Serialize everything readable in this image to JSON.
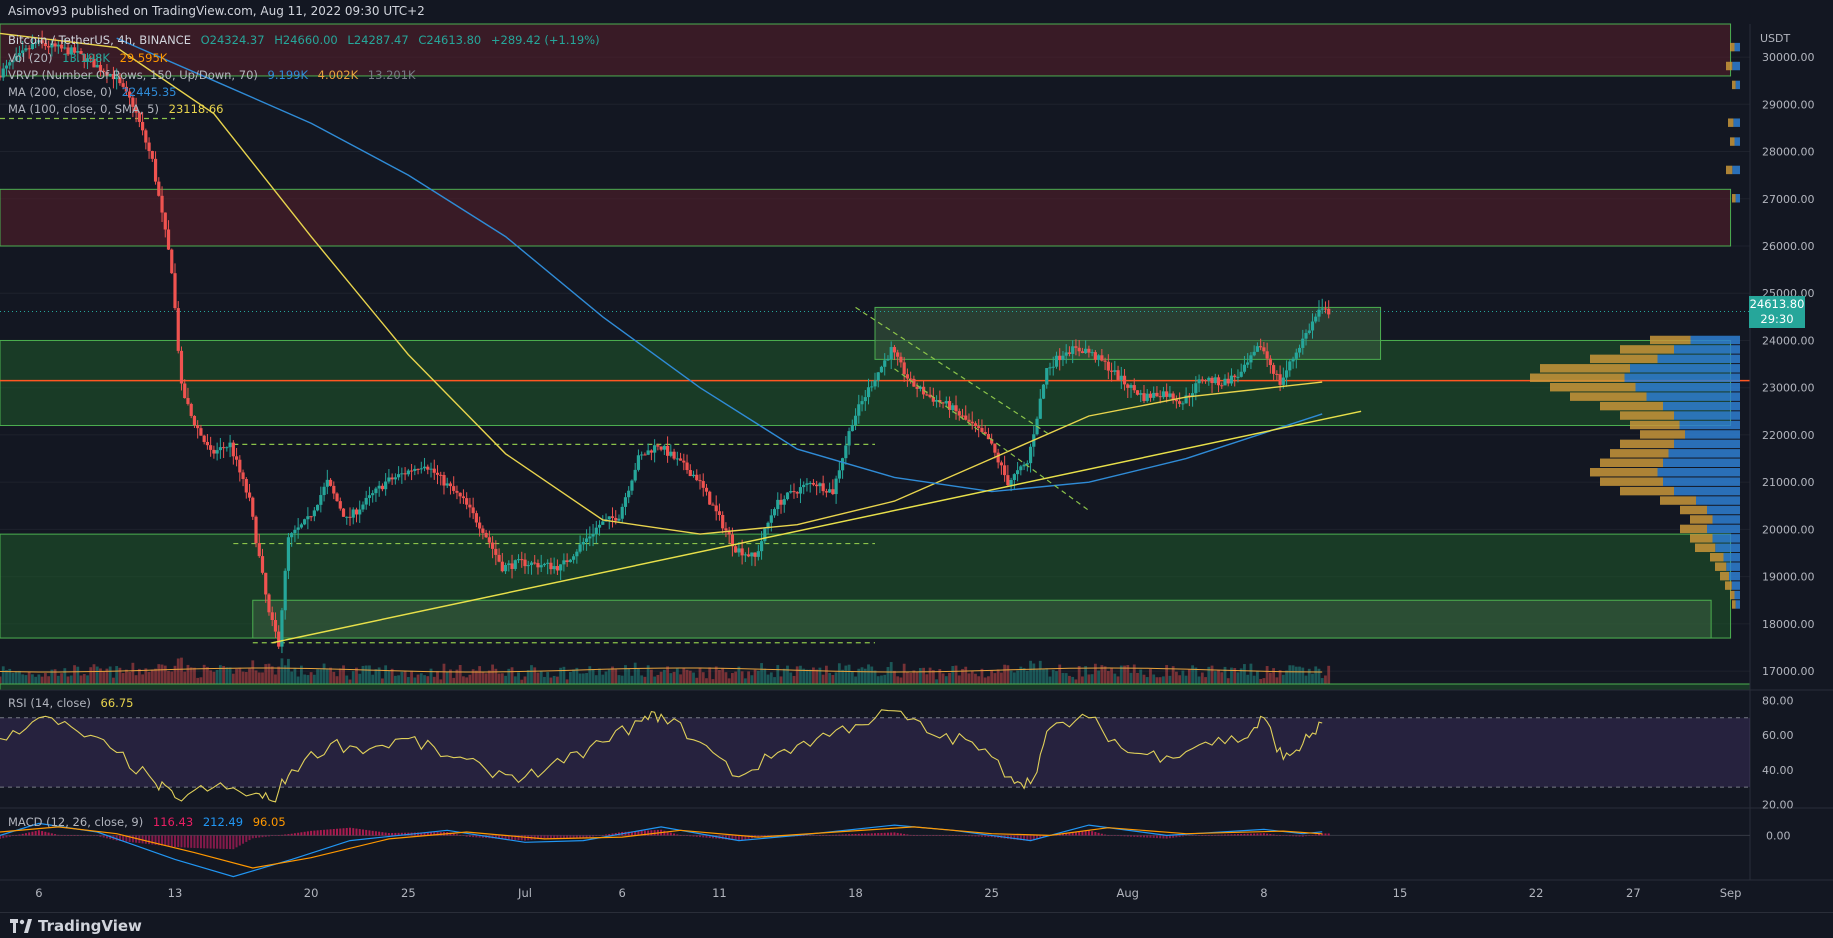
{
  "header": {
    "publisher": "Asimov93 published on TradingView.com, Aug 11, 2022 09:30 UTC+2"
  },
  "legend": {
    "symbol": "Bitcoin / TetherUS, 4h, BINANCE",
    "open": "O24324.37",
    "high": "H24660.00",
    "low": "L24287.47",
    "close": "C24613.80",
    "change": "+289.42 (+1.19%)",
    "vol_label": "Vol (20)",
    "vol_v1": "13.198K",
    "vol_v2": "29.595K",
    "vrvp_label": "VRVP (Number Of Rows, 150, Up/Down, 70)",
    "vrvp_v1": "9.199K",
    "vrvp_v2": "4.002K",
    "vrvp_v3": "13.201K",
    "ma200_label": "MA (200, close, 0)",
    "ma200_value": "22445.35",
    "ma100_label": "MA (100, close, 0, SMA, 5)",
    "ma100_value": "23118.66",
    "rsi_label": "RSI (14, close)",
    "rsi_value": "66.75",
    "macd_label": "MACD (12, 26, close, 9)",
    "macd_v1": "116.43",
    "macd_v2": "212.49",
    "macd_v3": "96.05"
  },
  "price_tag": {
    "price": "24613.80",
    "countdown": "29:30"
  },
  "footer": {
    "brand": "TradingView"
  },
  "colors": {
    "background": "#131722",
    "up": "#26a69a",
    "down": "#ef5350",
    "ma100": "#e8d44d",
    "ma200": "#2f8bd6",
    "zone_green": "#1f5a2a",
    "zone_red": "#5a1f2a",
    "rsi": "#e0d05a",
    "macd": "#2196f3",
    "signal": "#ff9800"
  },
  "chart_data": [
    {
      "type": "candlestick",
      "title": "Bitcoin / TetherUS, 4h, BINANCE",
      "y_axis_label": "USDT",
      "yticks": [
        17000,
        18000,
        19000,
        20000,
        21000,
        22000,
        23000,
        24000,
        25000,
        26000,
        27000,
        28000,
        29000,
        30000
      ],
      "xticks": [
        "6",
        "13",
        "20",
        "25",
        "Jul",
        "6",
        "11",
        "18",
        "25",
        "Aug",
        "8",
        "15",
        "22",
        "27",
        "Sep"
      ],
      "ylim": [
        16600,
        30700
      ],
      "x_range": [
        "2022-06-04",
        "2022-09-02"
      ],
      "price_path": [
        [
          "2022-06-04",
          29600
        ],
        [
          "2022-06-06",
          30300
        ],
        [
          "2022-06-08",
          30100
        ],
        [
          "2022-06-10",
          29600
        ],
        [
          "2022-06-11",
          29000
        ],
        [
          "2022-06-12",
          27800
        ],
        [
          "2022-06-13",
          25500
        ],
        [
          "2022-06-13T12",
          23000
        ],
        [
          "2022-06-14",
          22400
        ],
        [
          "2022-06-15",
          21600
        ],
        [
          "2022-06-16",
          21800
        ],
        [
          "2022-06-17",
          20600
        ],
        [
          "2022-06-18",
          18200
        ],
        [
          "2022-06-18T12",
          17600
        ],
        [
          "2022-06-19",
          19800
        ],
        [
          "2022-06-20",
          20200
        ],
        [
          "2022-06-21",
          21000
        ],
        [
          "2022-06-22",
          20200
        ],
        [
          "2022-06-24",
          21000
        ],
        [
          "2022-06-26",
          21400
        ],
        [
          "2022-06-28",
          20600
        ],
        [
          "2022-06-29",
          20000
        ],
        [
          "2022-06-30",
          19200
        ],
        [
          "2022-07-01",
          19300
        ],
        [
          "2022-07-03",
          19200
        ],
        [
          "2022-07-05",
          20100
        ],
        [
          "2022-07-06",
          20300
        ],
        [
          "2022-07-07",
          21500
        ],
        [
          "2022-07-08",
          21800
        ],
        [
          "2022-07-10",
          21100
        ],
        [
          "2022-07-12",
          19600
        ],
        [
          "2022-07-13",
          19400
        ],
        [
          "2022-07-14",
          20500
        ],
        [
          "2022-07-15",
          20800
        ],
        [
          "2022-07-16",
          21000
        ],
        [
          "2022-07-17",
          20800
        ],
        [
          "2022-07-18",
          22300
        ],
        [
          "2022-07-19",
          23100
        ],
        [
          "2022-07-20",
          23800
        ],
        [
          "2022-07-21",
          23100
        ],
        [
          "2022-07-22",
          22800
        ],
        [
          "2022-07-23",
          22600
        ],
        [
          "2022-07-25",
          21900
        ],
        [
          "2022-07-26",
          21000
        ],
        [
          "2022-07-27",
          21400
        ],
        [
          "2022-07-28",
          23400
        ],
        [
          "2022-07-29",
          23800
        ],
        [
          "2022-07-30",
          23800
        ],
        [
          "2022-07-31",
          23500
        ],
        [
          "2022-08-01",
          23100
        ],
        [
          "2022-08-02",
          22800
        ],
        [
          "2022-08-03",
          22900
        ],
        [
          "2022-08-04",
          22700
        ],
        [
          "2022-08-05",
          23200
        ],
        [
          "2022-08-06",
          23100
        ],
        [
          "2022-08-07",
          23300
        ],
        [
          "2022-08-08",
          23900
        ],
        [
          "2022-08-09",
          23100
        ],
        [
          "2022-08-10",
          23900
        ],
        [
          "2022-08-11",
          24614
        ]
      ],
      "ma100": [
        [
          "2022-06-04",
          30500
        ],
        [
          "2022-06-10",
          30200
        ],
        [
          "2022-06-15",
          28800
        ],
        [
          "2022-06-20",
          26200
        ],
        [
          "2022-06-25",
          23700
        ],
        [
          "2022-06-30",
          21600
        ],
        [
          "2022-07-05",
          20200
        ],
        [
          "2022-07-10",
          19900
        ],
        [
          "2022-07-15",
          20100
        ],
        [
          "2022-07-20",
          20600
        ],
        [
          "2022-07-25",
          21500
        ],
        [
          "2022-07-30",
          22400
        ],
        [
          "2022-08-04",
          22800
        ],
        [
          "2022-08-11",
          23119
        ]
      ],
      "ma200": [
        [
          "2022-06-10",
          30400
        ],
        [
          "2022-06-15",
          29500
        ],
        [
          "2022-06-20",
          28600
        ],
        [
          "2022-06-25",
          27500
        ],
        [
          "2022-06-30",
          26200
        ],
        [
          "2022-07-05",
          24500
        ],
        [
          "2022-07-10",
          23000
        ],
        [
          "2022-07-15",
          21700
        ],
        [
          "2022-07-20",
          21100
        ],
        [
          "2022-07-25",
          20800
        ],
        [
          "2022-07-30",
          21000
        ],
        [
          "2022-08-04",
          21500
        ],
        [
          "2022-08-11",
          22445
        ]
      ],
      "zones": [
        {
          "kind": "resistance",
          "y": [
            29600,
            30700
          ],
          "x": [
            "2022-06-04",
            "2022-09-01"
          ]
        },
        {
          "kind": "resistance",
          "y": [
            26000,
            27200
          ],
          "x": [
            "2022-06-04",
            "2022-09-01"
          ]
        },
        {
          "kind": "support",
          "y": [
            22200,
            24000
          ],
          "x": [
            "2022-06-04",
            "2022-09-01"
          ]
        },
        {
          "kind": "support",
          "y": [
            17700,
            19900
          ],
          "x": [
            "2022-06-04",
            "2022-09-01"
          ]
        },
        {
          "kind": "box",
          "y": [
            17700,
            18500
          ],
          "x": [
            "2022-06-17",
            "2022-08-31"
          ]
        },
        {
          "kind": "box",
          "y": [
            23600,
            24700
          ],
          "x": [
            "2022-07-19",
            "2022-08-14"
          ]
        }
      ],
      "levels": [
        {
          "y": 23150,
          "style": "solid",
          "color": "#ff5722"
        },
        {
          "y": 28700,
          "style": "dashed",
          "x": [
            "2022-06-04",
            "2022-06-13"
          ]
        },
        {
          "y": 21800,
          "style": "dashed",
          "x": [
            "2022-06-16",
            "2022-07-19"
          ]
        },
        {
          "y": 19700,
          "style": "dashed",
          "x": [
            "2022-06-16",
            "2022-07-19"
          ]
        },
        {
          "y": 17600,
          "style": "dashed",
          "x": [
            "2022-06-17",
            "2022-07-19"
          ]
        }
      ],
      "trendline": [
        [
          "2022-06-18",
          17600
        ],
        [
          "2022-08-13",
          22500
        ]
      ],
      "channel": [
        [
          [
            "2022-07-18",
            24700
          ],
          [
            "2022-07-28",
            22000
          ]
        ],
        [
          [
            "2022-07-20",
            23400
          ],
          [
            "2022-07-30",
            20400
          ]
        ]
      ],
      "volume_profile": [
        [
          30200,
          10
        ],
        [
          29800,
          14
        ],
        [
          29400,
          8
        ],
        [
          28600,
          12
        ],
        [
          28200,
          10
        ],
        [
          27600,
          14
        ],
        [
          27000,
          8
        ],
        [
          24000,
          90
        ],
        [
          23800,
          120
        ],
        [
          23600,
          150
        ],
        [
          23400,
          200
        ],
        [
          23200,
          210
        ],
        [
          23000,
          190
        ],
        [
          22800,
          170
        ],
        [
          22600,
          140
        ],
        [
          22400,
          120
        ],
        [
          22200,
          110
        ],
        [
          22000,
          100
        ],
        [
          21800,
          120
        ],
        [
          21600,
          130
        ],
        [
          21400,
          140
        ],
        [
          21200,
          150
        ],
        [
          21000,
          140
        ],
        [
          20800,
          120
        ],
        [
          20600,
          80
        ],
        [
          20400,
          60
        ],
        [
          20200,
          50
        ],
        [
          20000,
          60
        ],
        [
          19800,
          50
        ],
        [
          19600,
          45
        ],
        [
          19400,
          30
        ],
        [
          19200,
          25
        ],
        [
          19000,
          20
        ],
        [
          18800,
          15
        ],
        [
          18600,
          10
        ],
        [
          18400,
          8
        ]
      ]
    },
    {
      "type": "line",
      "title": "RSI (14, close)",
      "yticks": [
        20,
        40,
        60,
        80
      ],
      "ylim": [
        18,
        86
      ],
      "bands": [
        30,
        70
      ],
      "values": [
        [
          "2022-06-04",
          58
        ],
        [
          "2022-06-06",
          70
        ],
        [
          "2022-06-08",
          62
        ],
        [
          "2022-06-10",
          50
        ],
        [
          "2022-06-12",
          32
        ],
        [
          "2022-06-13",
          24
        ],
        [
          "2022-06-15",
          30
        ],
        [
          "2022-06-17",
          26
        ],
        [
          "2022-06-18",
          22
        ],
        [
          "2022-06-19",
          40
        ],
        [
          "2022-06-21",
          55
        ],
        [
          "2022-06-23",
          52
        ],
        [
          "2022-06-25",
          58
        ],
        [
          "2022-06-27",
          48
        ],
        [
          "2022-06-29",
          40
        ],
        [
          "2022-07-01",
          36
        ],
        [
          "2022-07-03",
          44
        ],
        [
          "2022-07-05",
          56
        ],
        [
          "2022-07-07",
          68
        ],
        [
          "2022-07-08",
          72
        ],
        [
          "2022-07-10",
          56
        ],
        [
          "2022-07-12",
          36
        ],
        [
          "2022-07-14",
          50
        ],
        [
          "2022-07-16",
          58
        ],
        [
          "2022-07-18",
          66
        ],
        [
          "2022-07-20",
          74
        ],
        [
          "2022-07-22",
          60
        ],
        [
          "2022-07-24",
          56
        ],
        [
          "2022-07-26",
          36
        ],
        [
          "2022-07-27",
          32
        ],
        [
          "2022-07-28",
          64
        ],
        [
          "2022-07-30",
          70
        ],
        [
          "2022-08-01",
          50
        ],
        [
          "2022-08-03",
          48
        ],
        [
          "2022-08-05",
          56
        ],
        [
          "2022-08-07",
          58
        ],
        [
          "2022-08-08",
          70
        ],
        [
          "2022-08-09",
          46
        ],
        [
          "2022-08-10",
          55
        ],
        [
          "2022-08-11",
          67
        ]
      ]
    },
    {
      "type": "line",
      "title": "MACD (12, 26, close, 9)",
      "yticks": [
        0
      ],
      "ylim": [
        -2600,
        1600
      ],
      "macd": [
        [
          "2022-06-04",
          0
        ],
        [
          "2022-06-06",
          700
        ],
        [
          "2022-06-09",
          200
        ],
        [
          "2022-06-13",
          -1400
        ],
        [
          "2022-06-16",
          -2400
        ],
        [
          "2022-06-19",
          -1400
        ],
        [
          "2022-06-22",
          -300
        ],
        [
          "2022-06-27",
          300
        ],
        [
          "2022-07-01",
          -400
        ],
        [
          "2022-07-04",
          -300
        ],
        [
          "2022-07-08",
          500
        ],
        [
          "2022-07-12",
          -300
        ],
        [
          "2022-07-15",
          0
        ],
        [
          "2022-07-20",
          600
        ],
        [
          "2022-07-23",
          300
        ],
        [
          "2022-07-27",
          -300
        ],
        [
          "2022-07-30",
          600
        ],
        [
          "2022-08-03",
          0
        ],
        [
          "2022-08-08",
          350
        ],
        [
          "2022-08-10",
          100
        ],
        [
          "2022-08-11",
          212
        ]
      ],
      "signal": [
        [
          "2022-06-04",
          200
        ],
        [
          "2022-06-07",
          500
        ],
        [
          "2022-06-10",
          100
        ],
        [
          "2022-06-14",
          -1000
        ],
        [
          "2022-06-17",
          -1900
        ],
        [
          "2022-06-20",
          -1300
        ],
        [
          "2022-06-24",
          -200
        ],
        [
          "2022-06-28",
          200
        ],
        [
          "2022-07-02",
          -200
        ],
        [
          "2022-07-06",
          -100
        ],
        [
          "2022-07-09",
          300
        ],
        [
          "2022-07-13",
          -100
        ],
        [
          "2022-07-17",
          200
        ],
        [
          "2022-07-21",
          500
        ],
        [
          "2022-07-25",
          100
        ],
        [
          "2022-07-28",
          0
        ],
        [
          "2022-07-31",
          450
        ],
        [
          "2022-08-04",
          100
        ],
        [
          "2022-08-09",
          250
        ],
        [
          "2022-08-11",
          96
        ]
      ]
    }
  ]
}
